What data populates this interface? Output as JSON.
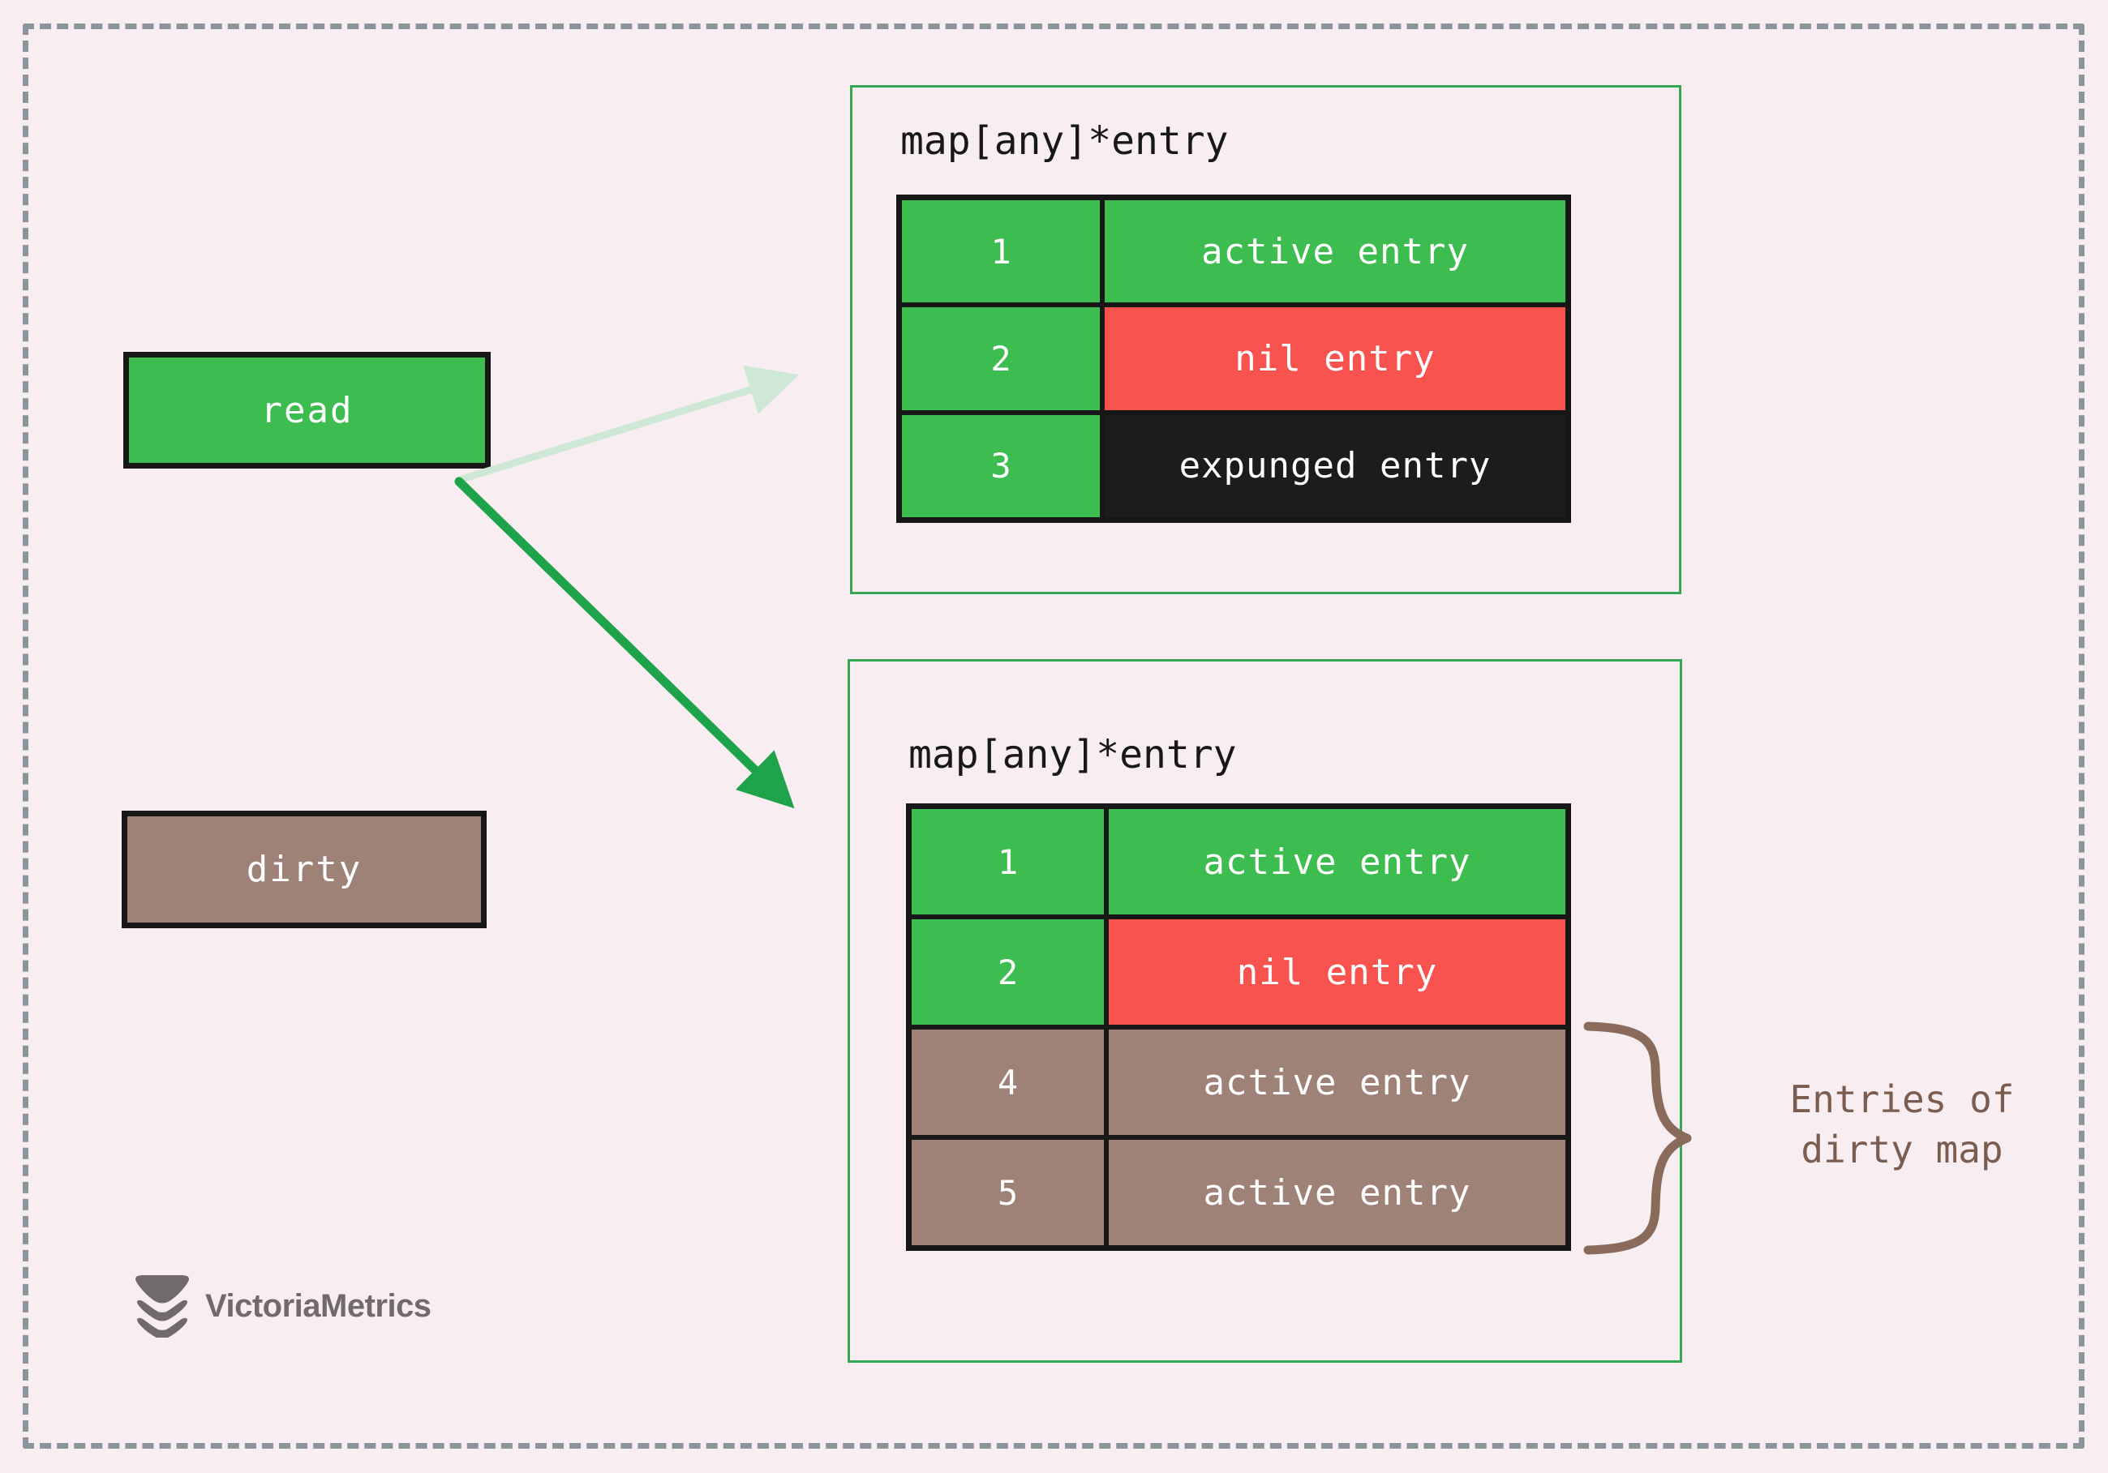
{
  "canvas": {
    "background_color": "#f8eef2",
    "frame_border_color": "#8a949a"
  },
  "legend_boxes": [
    {
      "id": "read",
      "label": "read",
      "color": "#3dbd4f"
    },
    {
      "id": "dirty",
      "label": "dirty",
      "color": "#9e8177"
    }
  ],
  "panels": [
    {
      "id": "read-map",
      "title": "map[any]*entry",
      "border_color": "#35a853",
      "rows": [
        {
          "key": "1",
          "value": "active entry",
          "key_color": "#3dbd4f",
          "value_color": "#3dbd4f"
        },
        {
          "key": "2",
          "value": "nil entry",
          "key_color": "#3dbd4f",
          "value_color": "#f9534f"
        },
        {
          "key": "3",
          "value": "expunged entry",
          "key_color": "#3dbd4f",
          "value_color": "#1c1c1c"
        }
      ]
    },
    {
      "id": "dirty-map",
      "title": "map[any]*entry",
      "border_color": "#35a853",
      "rows": [
        {
          "key": "1",
          "value": "active entry",
          "key_color": "#3dbd4f",
          "value_color": "#3dbd4f"
        },
        {
          "key": "2",
          "value": "nil entry",
          "key_color": "#3dbd4f",
          "value_color": "#f9534f"
        },
        {
          "key": "4",
          "value": "active entry",
          "key_color": "#9e8177",
          "value_color": "#9e8177"
        },
        {
          "key": "5",
          "value": "active entry",
          "key_color": "#9e8177",
          "value_color": "#9e8177"
        }
      ]
    }
  ],
  "annotation": {
    "brace_label": "Entries of\ndirty map",
    "brace_color": "#7b5d4f"
  },
  "arrows": [
    {
      "id": "read-to-read-map",
      "color": "#cfe8d5",
      "style": "faded"
    },
    {
      "id": "read-to-dirty-map",
      "color": "#1fa34a",
      "style": "solid"
    }
  ],
  "logo": {
    "text": "VictoriaMetrics",
    "color": "#716a6d"
  }
}
